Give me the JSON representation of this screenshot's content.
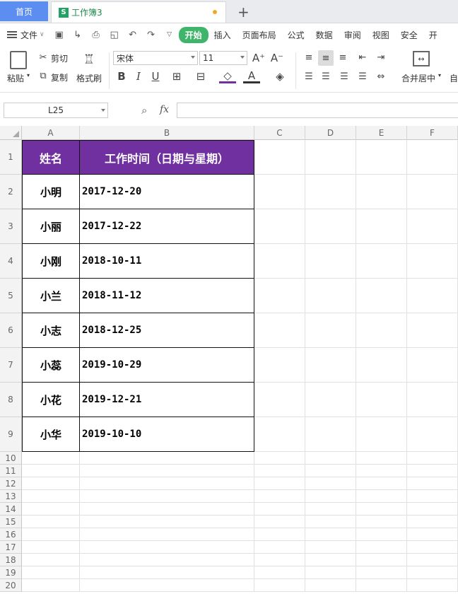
{
  "tabs": {
    "home": "首页",
    "doc": "工作簿3",
    "new_tab": "+"
  },
  "menu": {
    "file": "文件",
    "tabs": [
      "开始",
      "插入",
      "页面布局",
      "公式",
      "数据",
      "审阅",
      "视图",
      "安全",
      "开"
    ]
  },
  "ribbon": {
    "paste": "粘贴",
    "cut": "剪切",
    "copy": "复制",
    "format_painter": "格式刷",
    "font_name": "宋体",
    "font_size": "11",
    "merge_center": "合并居中",
    "auto": "自"
  },
  "formula_bar": {
    "cell_ref": "L25",
    "fx": "fx",
    "content": ""
  },
  "sheet": {
    "columns": [
      "A",
      "B",
      "C",
      "D",
      "E",
      "F"
    ],
    "header": [
      "姓名",
      "工作时间（日期与星期）"
    ],
    "rows": [
      [
        "小明",
        "2017-12-20"
      ],
      [
        "小丽",
        "2017-12-22"
      ],
      [
        "小刚",
        "2018-10-11"
      ],
      [
        "小兰",
        "2018-11-12"
      ],
      [
        "小志",
        "2018-12-25"
      ],
      [
        "小蕊",
        "2019-10-29"
      ],
      [
        "小花",
        "2019-12-21"
      ],
      [
        "小华",
        "2019-10-10"
      ]
    ],
    "row_numbers": [
      "1",
      "2",
      "3",
      "4",
      "5",
      "6",
      "7",
      "8",
      "9",
      "10",
      "11",
      "12",
      "13",
      "14",
      "15",
      "16",
      "17",
      "18",
      "19",
      "20"
    ],
    "header_color": "#7030a0"
  }
}
